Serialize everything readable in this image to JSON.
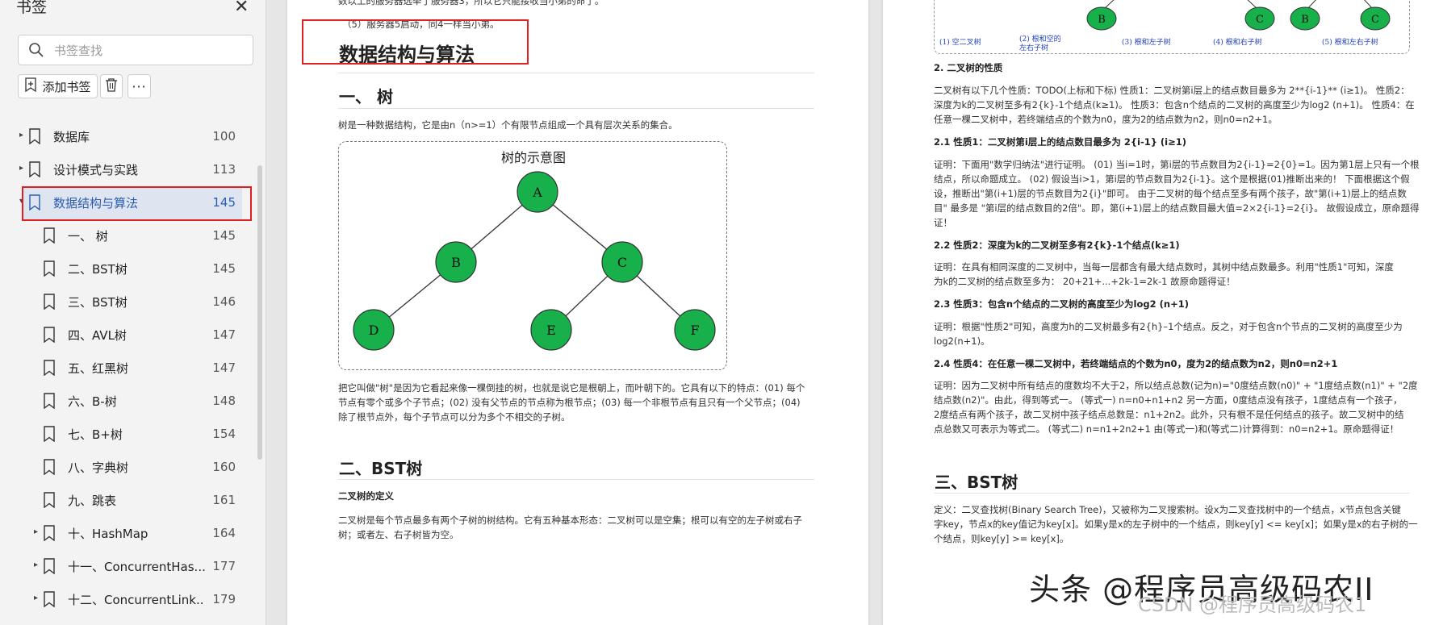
{
  "sidebar": {
    "title": "书签",
    "search_placeholder": "书签查找",
    "add_label": "添加书签",
    "more_label": "···",
    "items": [
      {
        "label": "数据库",
        "page": "100",
        "level": 0,
        "expandable": true,
        "active": false
      },
      {
        "label": "设计模式与实践",
        "page": "113",
        "level": 0,
        "expandable": true,
        "active": false
      },
      {
        "label": "数据结构与算法",
        "page": "145",
        "level": 0,
        "expandable": true,
        "active": true
      },
      {
        "label": "一、 树",
        "page": "145",
        "level": 1,
        "expandable": false,
        "active": false
      },
      {
        "label": "二、BST树",
        "page": "145",
        "level": 1,
        "expandable": false,
        "active": false
      },
      {
        "label": "三、BST树",
        "page": "146",
        "level": 1,
        "expandable": false,
        "active": false
      },
      {
        "label": "四、AVL树",
        "page": "147",
        "level": 1,
        "expandable": false,
        "active": false
      },
      {
        "label": "五、红黑树",
        "page": "147",
        "level": 1,
        "expandable": false,
        "active": false
      },
      {
        "label": "六、B-树",
        "page": "148",
        "level": 1,
        "expandable": false,
        "active": false
      },
      {
        "label": "七、B+树",
        "page": "154",
        "level": 1,
        "expandable": false,
        "active": false
      },
      {
        "label": "八、字典树",
        "page": "160",
        "level": 1,
        "expandable": false,
        "active": false
      },
      {
        "label": "九、跳表",
        "page": "161",
        "level": 1,
        "expandable": false,
        "active": false
      },
      {
        "label": "十、HashMap",
        "page": "164",
        "level": 1,
        "expandable": true,
        "active": false
      },
      {
        "label": "十一、ConcurrentHas...",
        "page": "177",
        "level": 1,
        "expandable": true,
        "active": false
      },
      {
        "label": "十二、ConcurrentLink...",
        "page": "179",
        "level": 1,
        "expandable": true,
        "active": false
      }
    ]
  },
  "left_page": {
    "top_line1": "数以上的服务器选举了服务器3，所以它只能接收当小弟的命了。",
    "top_line2": "（5）服务器5启动，同4一样当小弟。",
    "title": "数据结构与算法",
    "section1": "一、 树",
    "section1_intro": "树是一种数据结构，它是由n（n>=1）个有限节点组成一个具有层次关系的集合。",
    "tree_title": "树的示意图",
    "tree_nodes": [
      "A",
      "B",
      "C",
      "D",
      "E",
      "F"
    ],
    "tree_desc_lines": [
      "把它叫做\"树\"是因为它看起来像一棵倒挂的树，也就是说它是根朝上，而叶朝下的。它具有以下的特点：(01) 每个",
      "节点有零个或多个子节点；(02) 没有父节点的节点称为根节点；(03) 每一个非根节点有且只有一个父节点；(04)",
      "除了根节点外，每个子节点可以分为多个不相交的子树。"
    ],
    "section2": "二、BST树",
    "section2_sub": "二叉树的定义",
    "section2_lines": [
      "二叉树是每个节点最多有两个子树的树结构。它有五种基本形态：二叉树可以是空集；根可以有空的左子树或右子",
      "树；或者左、右子树皆为空。"
    ]
  },
  "right_page": {
    "fig_labels": [
      "(1) 空二叉树",
      "(2) 根和空的",
      "左右子树",
      "(3) 根和左子树",
      "(4) 根和右子树",
      "(5) 根和左右子树"
    ],
    "fig_nodes": [
      "B",
      "C",
      "B",
      "C"
    ],
    "h_props": "2. 二叉树的性质",
    "props_lines": [
      "二叉树有以下几个性质：TODO(上标和下标) 性质1：二叉树第i层上的结点数目最多为 2**{i-1}** (i≥1)。 性质2：",
      "深度为k的二叉树至多有2{k}-1个结点(k≥1)。 性质3：包含n个结点的二叉树的高度至少为log2 (n+1)。 性质4：在",
      "任意一棵二叉树中，若终端结点的个数为n0，度为2的结点数为n2，则n0=n2+1。"
    ],
    "h21": "2.1 性质1：二叉树第i层上的结点数目最多为 2{i-1} (i≥1)",
    "p21_lines": [
      "证明：下面用\"数学归纳法\"进行证明。 (01) 当i=1时，第i层的节点数目为2{i-1}=2{0}=1。因为第1层上只有一个根",
      "结点，所以命题成立。 (02) 假设当i>1，第i层的节点数目为2{i-1}。这个是根据(01)推断出来的！ 下面根据这个假",
      "设，推断出\"第(i+1)层的节点数目为2{i}\"即可。 由于二叉树的每个结点至多有两个孩子，故\"第(i+1)层上的结点数",
      "目\" 最多是 \"第i层的结点数目的2倍\"。即，第(i+1)层上的结点数目最大值=2×2{i-1}=2{i}。 故假设成立，原命题得",
      "证！"
    ],
    "h22": "2.2 性质2：深度为k的二叉树至多有2{k}-1个结点(k≥1)",
    "p22_lines": [
      "证明：在具有相同深度的二叉树中，当每一层都含有最大结点数时，其树中结点数最多。利用\"性质1\"可知，深度",
      "为k的二叉树的结点数至多为： 20+21+...+2k-1=2k-1 故原命题得证！"
    ],
    "h23": "2.3 性质3：包含n个结点的二叉树的高度至少为log2 (n+1)",
    "p23_lines": [
      "证明：根据\"性质2\"可知，高度为h的二叉树最多有2{h}–1个结点。反之，对于包含n个节点的二叉树的高度至少为",
      "log2(n+1)。"
    ],
    "h24": "2.4 性质4：在任意一棵二叉树中，若终端结点的个数为n0，度为2的结点数为n2，则n0=n2+1",
    "p24_lines": [
      "证明：因为二叉树中所有结点的度数均不大于2，所以结点总数(记为n)=\"0度结点数(n0)\" + \"1度结点数(n1)\" + \"2度",
      "结点数(n2)\"。由此，得到等式一。 (等式一) n=n0+n1+n2    另一方面，0度结点没有孩子，1度结点有一个孩子，",
      "2度结点有两个孩子，故二叉树中孩子结点总数是：n1+2n2。此外，只有根不是任何结点的孩子。故二叉树中的结",
      "点总数又可表示为等式二。 (等式二) n=n1+2n2+1 由(等式一)和(等式二)计算得到：n0=n2+1。原命题得证！"
    ],
    "section3": "三、BST树",
    "p3_lines": [
      "定义：二叉查找树(Binary Search Tree)，又被称为二叉搜索树。设x为二叉查找树中的一个结点，x节点包含关键",
      "字key，节点x的key值记为key[x]。如果y是x的左子树中的一个结点，则key[y] <= key[x]；如果y是x的右子树的一",
      "个结点，则key[y] >= key[x]。"
    ]
  },
  "watermark": "头条 @程序员高级码农II",
  "watermark2": "CSDN @程序员高级码农1",
  "colors": {
    "node_fill": "#18b04a",
    "highlight": "#e02020",
    "active_text": "#2a5db0"
  }
}
